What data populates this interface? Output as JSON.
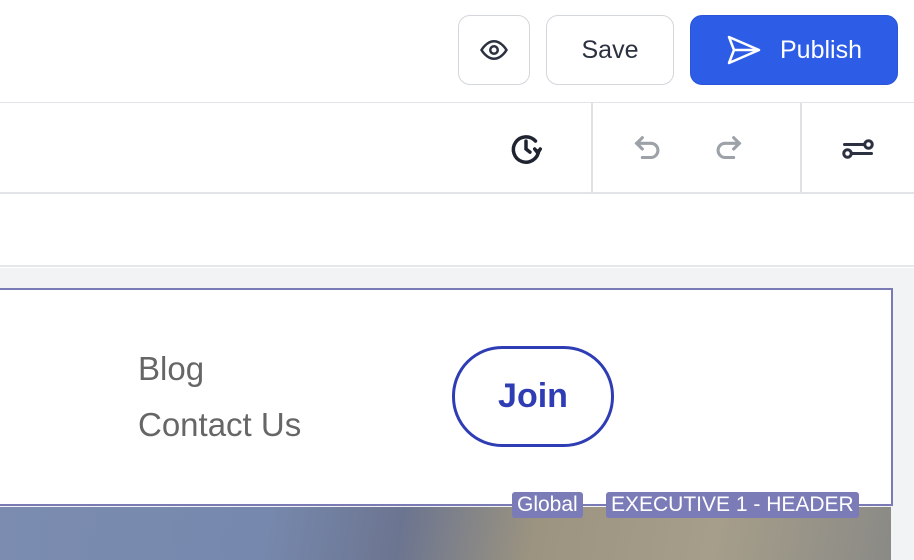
{
  "topbar": {
    "preview_icon": "eye-icon",
    "save_label": "Save",
    "publish_label": "Publish",
    "publish_icon": "send-icon",
    "publish_color": "#2d5ce6"
  },
  "toolbar": {
    "icons": [
      "history-icon",
      "undo-icon",
      "redo-icon",
      "settings-sliders-icon"
    ]
  },
  "section": {
    "nav_items": [
      "Blog",
      "Contact Us"
    ],
    "cta_label": "Join",
    "cta_color": "#2f3db5",
    "tags": [
      "Global",
      "EXECUTIVE 1 - HEADER"
    ],
    "outline_color": "#7a7ab4"
  }
}
